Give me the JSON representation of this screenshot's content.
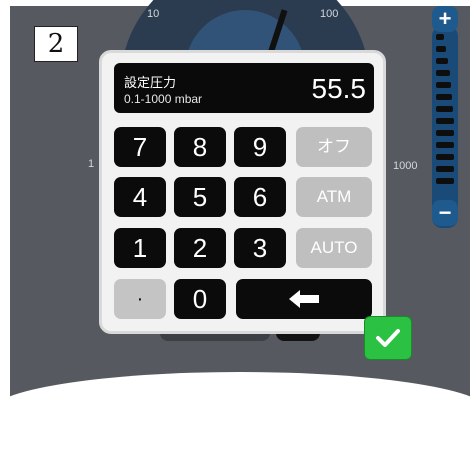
{
  "step": "2",
  "gauge": {
    "labels": [
      "10",
      "100",
      "1",
      "1000"
    ]
  },
  "side_ruler": {
    "plus": "+",
    "minus": "−"
  },
  "keypad": {
    "title": "設定圧力",
    "range": "0.1-1000 mbar",
    "value": "55.5",
    "keys": {
      "k7": "7",
      "k8": "8",
      "k9": "9",
      "off": "オフ",
      "k4": "4",
      "k5": "5",
      "k6": "6",
      "atm": "ATM",
      "k1": "1",
      "k2": "2",
      "k3": "3",
      "auto": "AUTO",
      "dot": "·",
      "k0": "0"
    },
    "backspace_icon": "left-arrow-icon",
    "confirm_icon": "checkmark-icon"
  },
  "colors": {
    "confirm": "#2bc142",
    "background": "#565a60",
    "key": "#0b0b0b",
    "key_gray": "#bfbfbf"
  }
}
